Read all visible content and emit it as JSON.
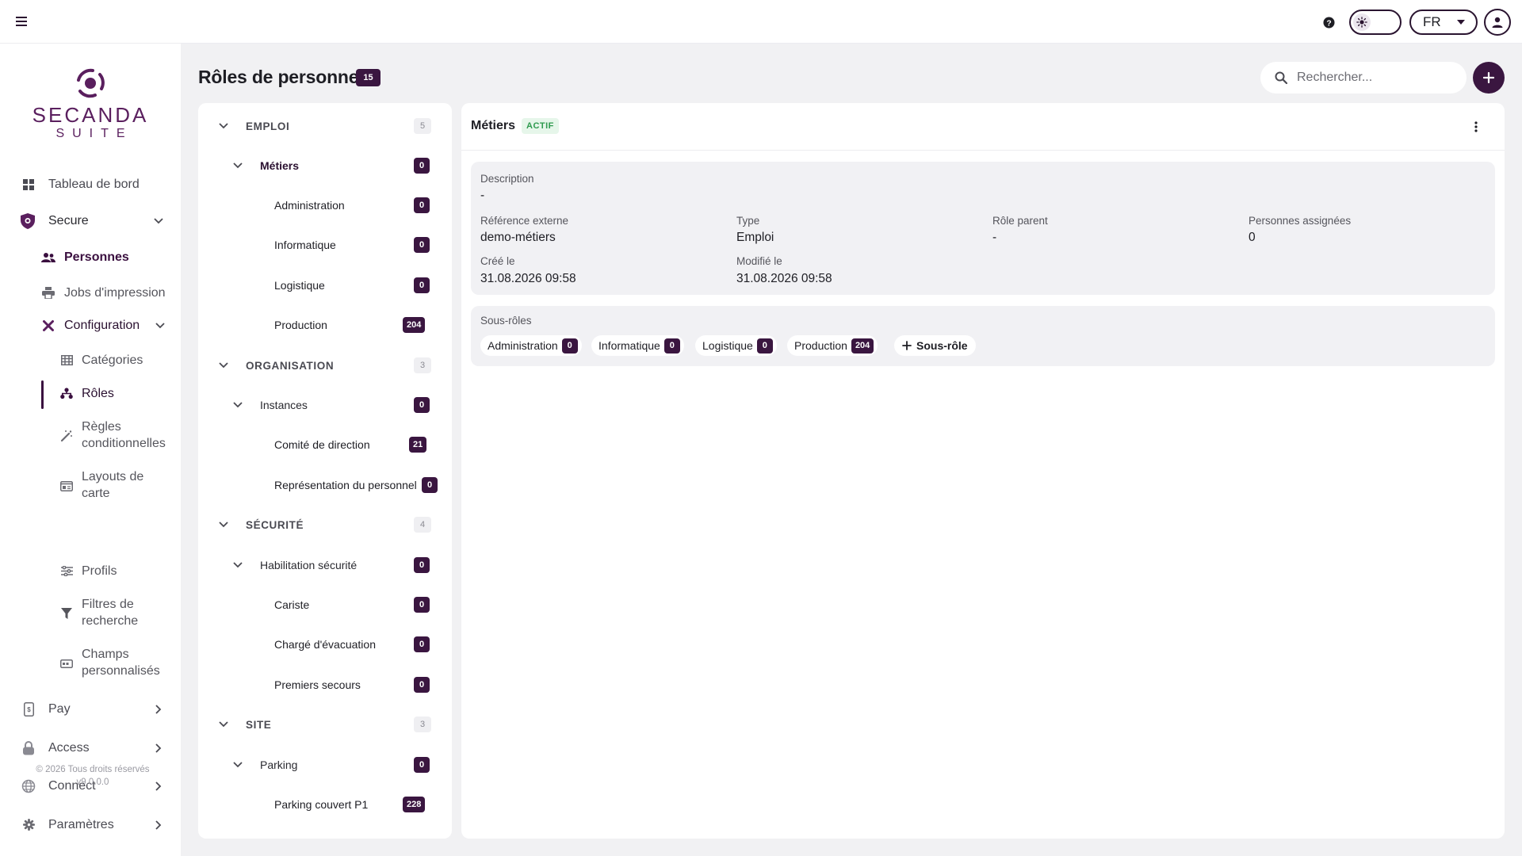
{
  "topbar": {
    "language": "FR"
  },
  "brand": {
    "name": "SECANDA",
    "sub": "SUITE"
  },
  "sidebar": {
    "items": [
      {
        "label": "Tableau de bord",
        "icon": "dashboard-icon"
      },
      {
        "label": "Secure",
        "icon": "shield-icon"
      },
      {
        "label": "Personnes",
        "icon": "people-icon"
      },
      {
        "label": "Jobs d'impression",
        "icon": "printer-icon"
      },
      {
        "label": "Configuration",
        "icon": "tools-icon"
      },
      {
        "label": "Catégories",
        "icon": "table-icon"
      },
      {
        "label": "Rôles",
        "icon": "hierarchy-icon"
      },
      {
        "label": "Règles conditionnelles",
        "icon": "magic-wand-icon"
      },
      {
        "label": "Layouts de carte",
        "icon": "id-card-icon"
      },
      {
        "label": "Profils",
        "icon": "sliders-icon"
      },
      {
        "label": "Filtres de recherche",
        "icon": "filter-icon"
      },
      {
        "label": "Champs personnalisés",
        "icon": "custom-field-icon"
      },
      {
        "label": "Pay",
        "icon": "payment-terminal-icon"
      },
      {
        "label": "Access",
        "icon": "lock-icon"
      },
      {
        "label": "Connect",
        "icon": "globe-icon"
      },
      {
        "label": "Paramètres",
        "icon": "gear-icon"
      }
    ],
    "copyright": "© 2026 Tous droits réservés",
    "version": "v9.0.0.0"
  },
  "page": {
    "title": "Rôles de personne",
    "count": "15"
  },
  "search": {
    "placeholder": "Rechercher..."
  },
  "tree": [
    {
      "label": "EMPLOI",
      "count": "5",
      "level": 0
    },
    {
      "label": "Métiers",
      "count": "0",
      "level": 1
    },
    {
      "label": "Administration",
      "count": "0",
      "level": 2
    },
    {
      "label": "Informatique",
      "count": "0",
      "level": 2
    },
    {
      "label": "Logistique",
      "count": "0",
      "level": 2
    },
    {
      "label": "Production",
      "count": "204",
      "level": 2
    },
    {
      "label": "ORGANISATION",
      "count": "3",
      "level": 0
    },
    {
      "label": "Instances",
      "count": "0",
      "level": 1
    },
    {
      "label": "Comité de direction",
      "count": "21",
      "level": 2
    },
    {
      "label": "Représentation du personnel",
      "count": "0",
      "level": 2
    },
    {
      "label": "SÉCURITÉ",
      "count": "4",
      "level": 0
    },
    {
      "label": "Habilitation sécurité",
      "count": "0",
      "level": 1
    },
    {
      "label": "Cariste",
      "count": "0",
      "level": 2
    },
    {
      "label": "Chargé d'évacuation",
      "count": "0",
      "level": 2
    },
    {
      "label": "Premiers secours",
      "count": "0",
      "level": 2
    },
    {
      "label": "SITE",
      "count": "3",
      "level": 0
    },
    {
      "label": "Parking",
      "count": "0",
      "level": 1
    },
    {
      "label": "Parking couvert P1",
      "count": "228",
      "level": 2
    }
  ],
  "detail": {
    "title": "Métiers",
    "status": "ACTIF",
    "description_label": "Description",
    "description_value": "-",
    "external_ref_label": "Référence externe",
    "external_ref_value": "demo-métiers",
    "type_label": "Type",
    "type_value": "Emploi",
    "parent_label": "Rôle parent",
    "parent_value": "-",
    "assigned_label": "Personnes assignées",
    "assigned_value": "0",
    "created_label": "Créé le",
    "created_value": "31.08.2026 09:58",
    "modified_label": "Modifié le",
    "modified_value": "31.08.2026 09:58",
    "subroles_label": "Sous-rôles",
    "subroles": [
      {
        "label": "Administration",
        "count": "0"
      },
      {
        "label": "Informatique",
        "count": "0"
      },
      {
        "label": "Logistique",
        "count": "0"
      },
      {
        "label": "Production",
        "count": "204"
      }
    ],
    "add_subrole": "Sous-rôle"
  },
  "colors": {
    "primary": "#3a1640",
    "brand": "#5a1f5e",
    "status_active": "#2e9a4e",
    "background": "#f1f1f3"
  }
}
